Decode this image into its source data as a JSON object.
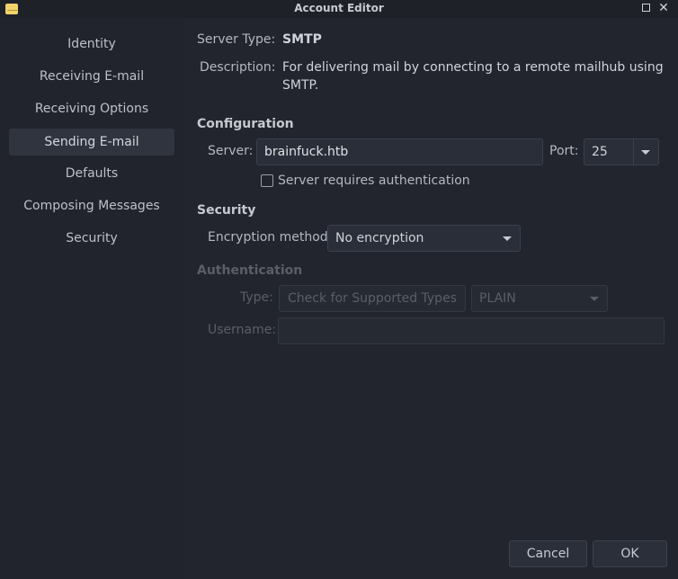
{
  "window": {
    "title": "Account Editor"
  },
  "sidebar": {
    "items": [
      {
        "label": "Identity"
      },
      {
        "label": "Receiving E-mail"
      },
      {
        "label": "Receiving Options"
      },
      {
        "label": "Sending E-mail"
      },
      {
        "label": "Defaults"
      },
      {
        "label": "Composing Messages"
      },
      {
        "label": "Security"
      }
    ],
    "selected": "Sending E-mail"
  },
  "server_type": {
    "label": "Server Type:",
    "value": "SMTP"
  },
  "description": {
    "label": "Description:",
    "line1": "For delivering mail by connecting to a remote mailhub using",
    "line2": "SMTP."
  },
  "configuration": {
    "heading": "Configuration",
    "server_label": "Server:",
    "server_value": "brainfuck.htb",
    "port_label": "Port:",
    "port_value": "25",
    "auth_checkbox_label": "Server requires authentication",
    "auth_checked": false
  },
  "security": {
    "heading": "Security",
    "encryption_label": "Encryption method:",
    "encryption_value": "No encryption"
  },
  "authentication": {
    "heading": "Authentication",
    "type_label": "Type:",
    "check_button": "Check for Supported Types",
    "type_value": "PLAIN",
    "username_label": "Username:",
    "username_value": ""
  },
  "footer": {
    "cancel": "Cancel",
    "ok": "OK"
  }
}
